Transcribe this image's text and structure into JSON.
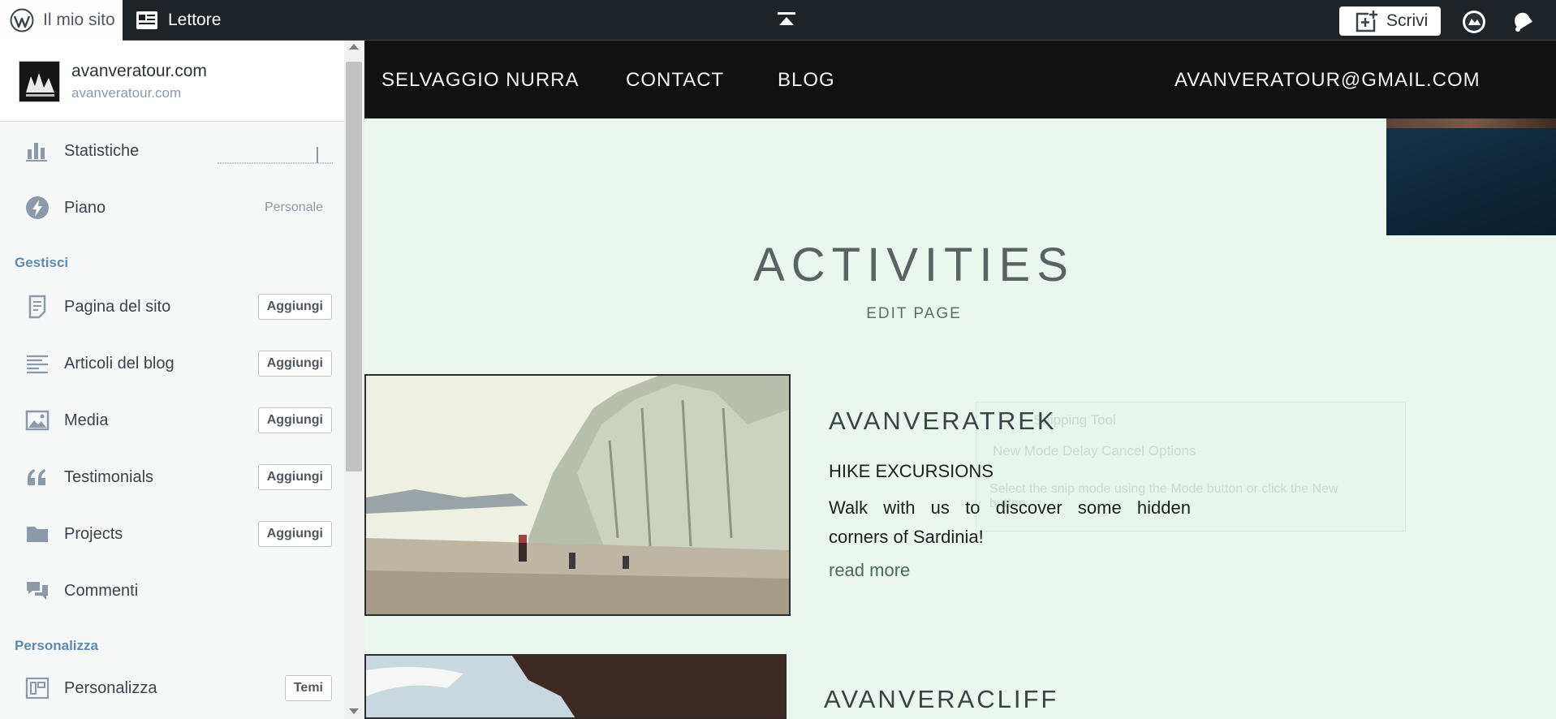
{
  "admin_bar": {
    "my_site_label": "Il mio sito",
    "reader_label": "Lettore",
    "write_label": "Scrivi"
  },
  "sidebar": {
    "site_name": "avanveratour.com",
    "site_url": "avanveratour.com",
    "stats_label": "Statistiche",
    "plan_label": "Piano",
    "plan_note": "Personale",
    "manage_section": "Gestisci",
    "items": [
      {
        "label": "Pagina del sito",
        "action": "Aggiungi",
        "icon": "page-icon"
      },
      {
        "label": "Articoli del blog",
        "action": "Aggiungi",
        "icon": "posts-icon"
      },
      {
        "label": "Media",
        "action": "Aggiungi",
        "icon": "media-icon"
      },
      {
        "label": "Testimonials",
        "action": "Aggiungi",
        "icon": "quote-icon"
      },
      {
        "label": "Projects",
        "action": "Aggiungi",
        "icon": "folder-icon"
      },
      {
        "label": "Commenti",
        "action": "",
        "icon": "comments-icon"
      }
    ],
    "personalize_section": "Personalizza",
    "customize_label": "Personalizza",
    "customize_action": "Temi"
  },
  "site_nav": {
    "items": [
      "SELVAGGIO NURRA",
      "CONTACT",
      "BLOG"
    ],
    "email": "AVANVERATOUR@GMAIL.COM"
  },
  "page": {
    "title": "ACTIVITIES",
    "edit_link": "EDIT PAGE",
    "cards": [
      {
        "title": "AVANVERATREK",
        "subtitle": "HIKE EXCURSIONS",
        "body": "Walk with us to discover some hidden corners of Sardinia!",
        "link": "read more"
      },
      {
        "title": "AVANVERACLIFF"
      }
    ]
  },
  "ghost_overlay": {
    "title": "Snipping Tool",
    "toolbar": "New   Mode   Delay   Cancel   Options",
    "hint": "Select the snip mode using the Mode button or click the New button."
  },
  "colors": {
    "admin_bar_bg": "#1d2327",
    "sidebar_bg": "#f6f7f7",
    "accent": "#5a8bb6",
    "page_bg": "#eaf6ee",
    "nav_bg": "#111111"
  }
}
